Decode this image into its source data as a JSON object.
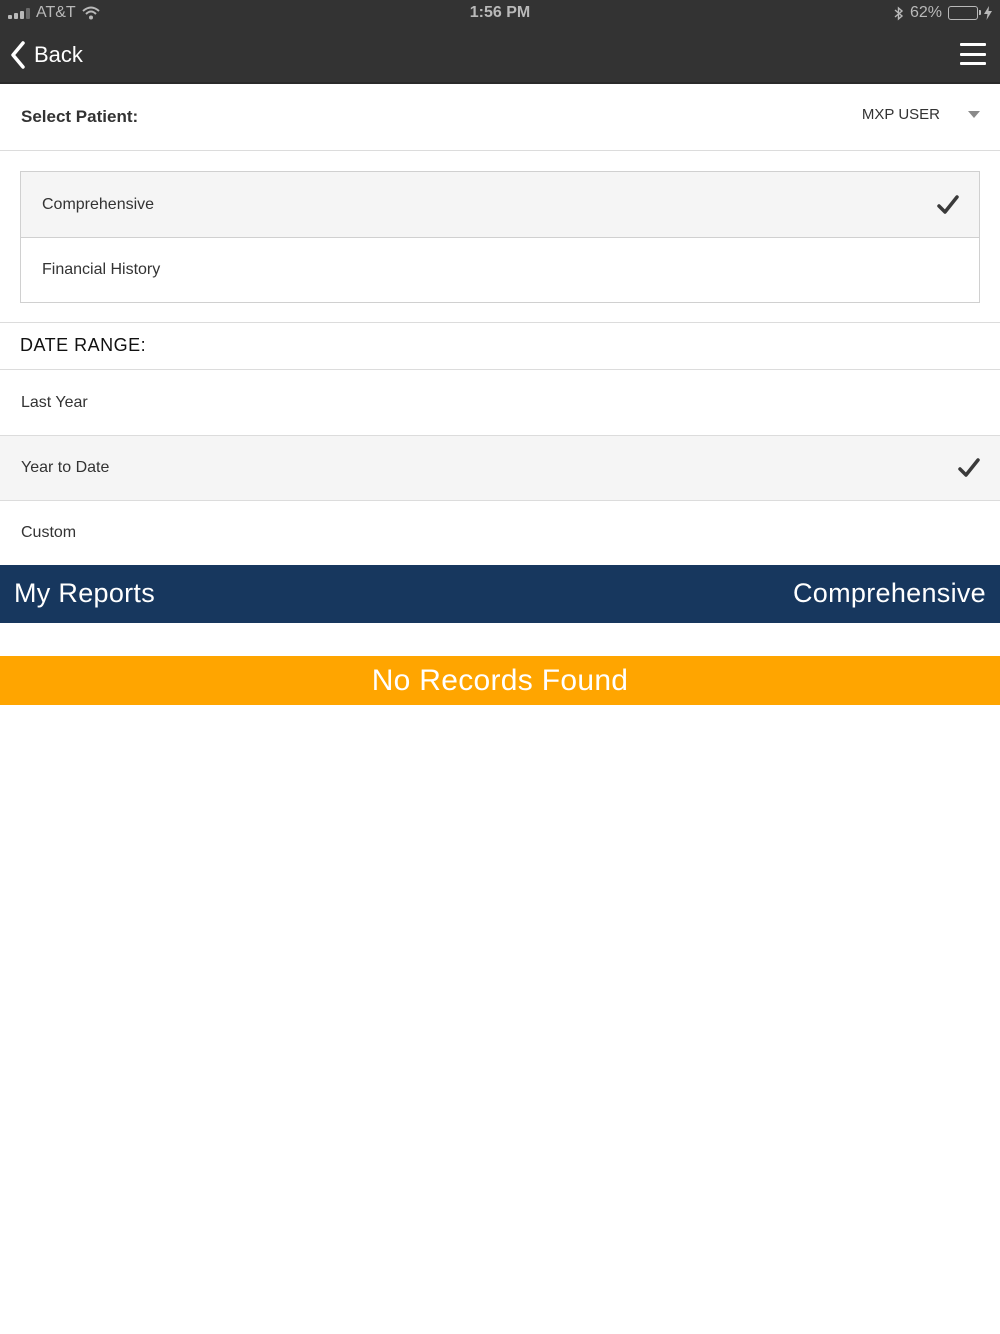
{
  "status_bar": {
    "carrier": "AT&T",
    "time": "1:56 PM",
    "battery_percent": "62%",
    "battery_level": 0.62,
    "battery_color": "#4cd964"
  },
  "nav": {
    "back_label": "Back",
    "back_icon": "chevron-left-icon",
    "menu_icon": "hamburger-menu-icon"
  },
  "patient": {
    "label": "Select Patient:",
    "selected": "MXP USER"
  },
  "report_types": [
    {
      "label": "Comprehensive",
      "selected": true
    },
    {
      "label": "Financial History",
      "selected": false
    }
  ],
  "date_range": {
    "heading": "DATE RANGE:",
    "options": [
      {
        "label": "Last Year",
        "selected": false
      },
      {
        "label": "Year to Date",
        "selected": true
      },
      {
        "label": "Custom",
        "selected": false
      }
    ]
  },
  "reports": {
    "title": "My Reports",
    "current_type": "Comprehensive",
    "bar_color": "#17375e"
  },
  "results": {
    "empty_message": "No Records Found",
    "banner_color": "#ffa500"
  }
}
